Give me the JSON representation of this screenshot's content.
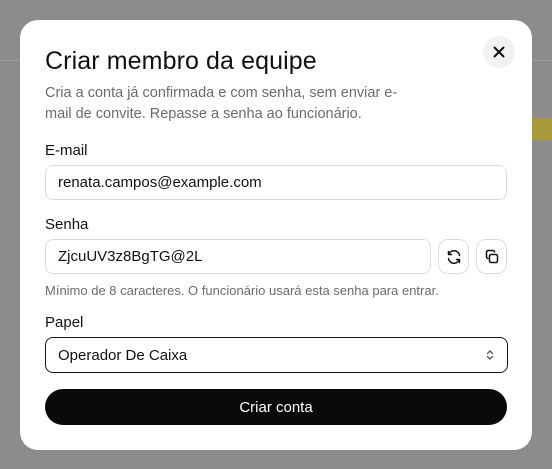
{
  "modal": {
    "title": "Criar membro da equipe",
    "subtitle": "Cria a conta já confirmada e com senha, sem enviar e-mail de convite. Repasse a senha ao funcionário.",
    "close_icon": "close-icon"
  },
  "email": {
    "label": "E-mail",
    "value": "renata.campos@example.com"
  },
  "password": {
    "label": "Senha",
    "value": "ZjcuUV3z8BgTG@2L",
    "hint": "Mínimo de 8 caracteres. O funcionário usará esta senha para entrar.",
    "regenerate_icon": "refresh-icon",
    "copy_icon": "copy-icon"
  },
  "role": {
    "label": "Papel",
    "selected": "Operador De Caixa",
    "icon": "chevron-up-down-icon"
  },
  "submit": {
    "label": "Criar conta"
  }
}
